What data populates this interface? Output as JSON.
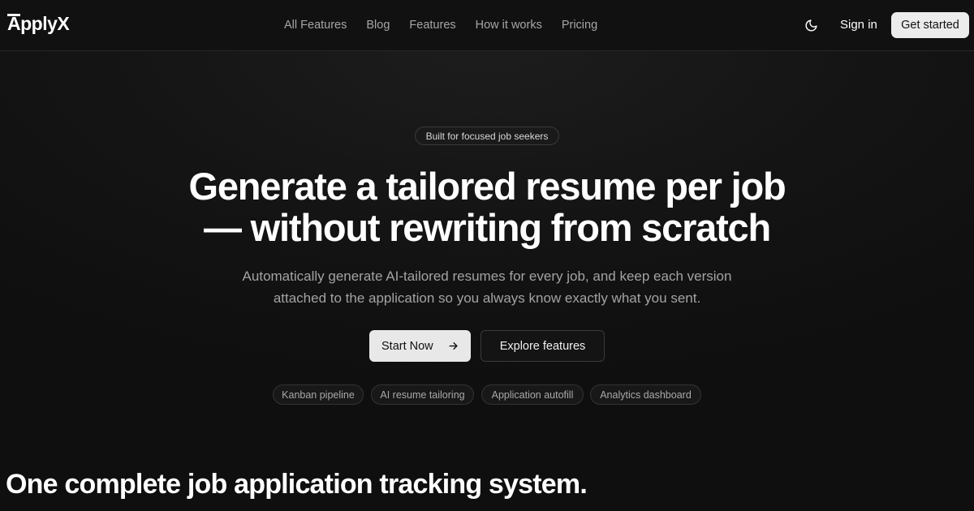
{
  "header": {
    "logo": "ApplyX",
    "nav": [
      "All Features",
      "Blog",
      "Features",
      "How it works",
      "Pricing"
    ],
    "theme_icon": "moon-icon",
    "sign_in": "Sign in",
    "get_started": "Get started"
  },
  "hero": {
    "badge": "Built for focused job seekers",
    "headline_line1": "Generate a tailored resume per job",
    "headline_line2": "— without rewriting from scratch",
    "subtext_line1": "Automatically generate AI-tailored resumes for every job, and keep each version",
    "subtext_line2": "attached to the application so you always know exactly what you sent.",
    "primary_cta": "Start Now",
    "primary_cta_icon": "arrow-right-icon",
    "secondary_cta": "Explore features",
    "chips": [
      "Kanban pipeline",
      "AI resume tailoring",
      "Application autofill",
      "Analytics dashboard"
    ]
  },
  "section": {
    "title": "One complete job application tracking system."
  },
  "colors": {
    "background": "#111111",
    "primary_button": "#e8e8e8",
    "text": "#ffffff",
    "muted_text": "#a3a3a3"
  }
}
